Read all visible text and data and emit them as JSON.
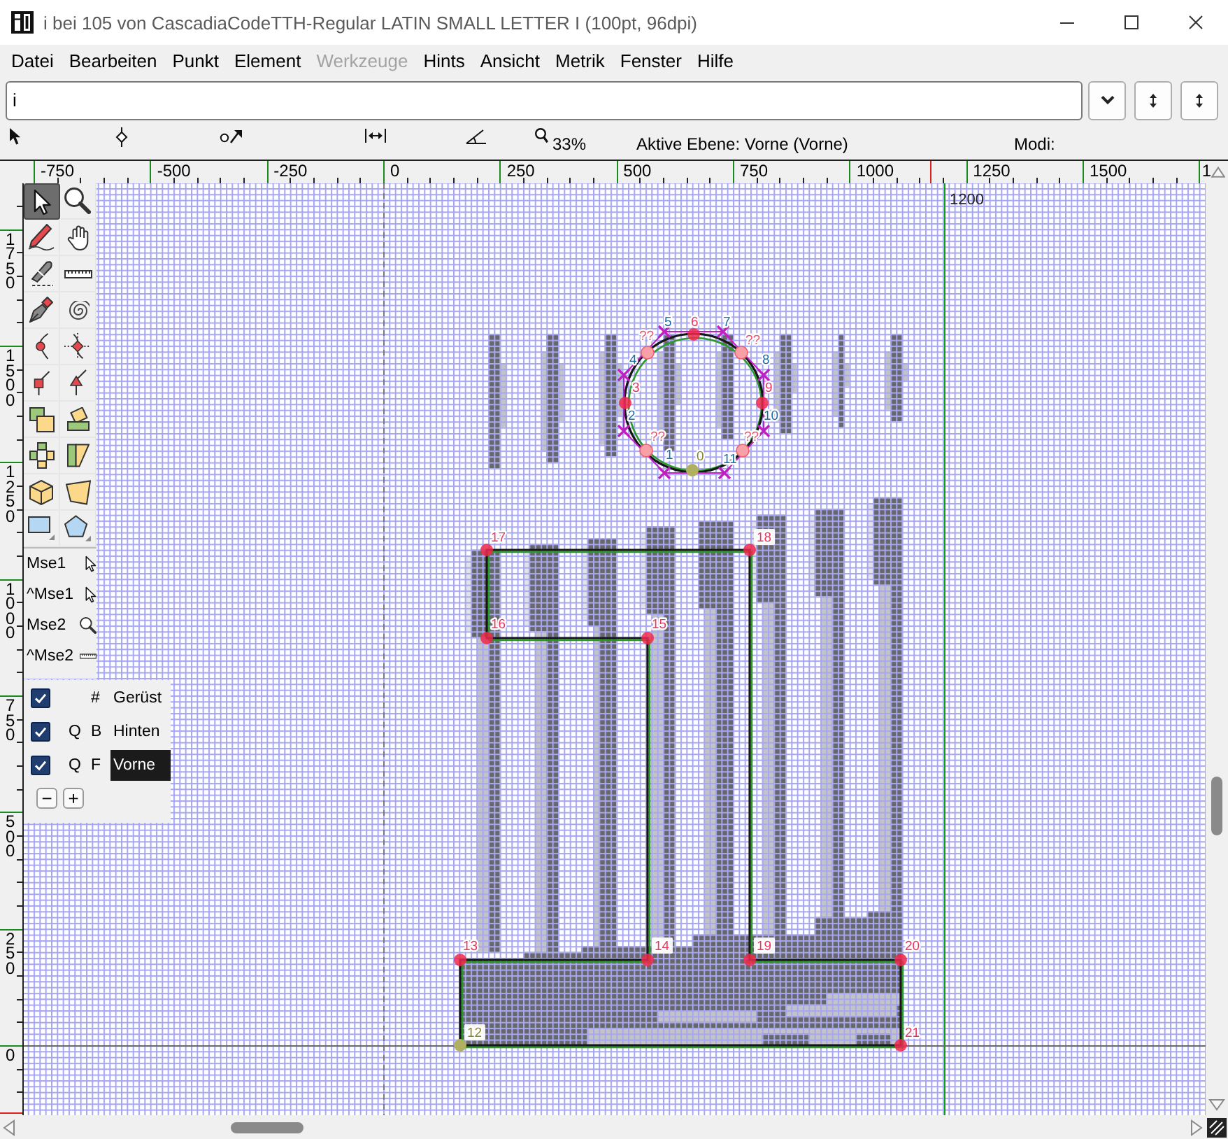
{
  "window": {
    "title": "i bei 105 von CascadiaCodeTTH-Regular LATIN SMALL LETTER I (100pt, 96dpi)"
  },
  "menu": [
    {
      "label": "Datei",
      "disabled": false
    },
    {
      "label": "Bearbeiten",
      "disabled": false
    },
    {
      "label": "Punkt",
      "disabled": false
    },
    {
      "label": "Element",
      "disabled": false
    },
    {
      "label": "Werkzeuge",
      "disabled": true
    },
    {
      "label": "Hints",
      "disabled": false
    },
    {
      "label": "Ansicht",
      "disabled": false
    },
    {
      "label": "Metrik",
      "disabled": false
    },
    {
      "label": "Fenster",
      "disabled": false
    },
    {
      "label": "Hilfe",
      "disabled": false
    }
  ],
  "glyph_field": {
    "value": "i"
  },
  "status": {
    "zoom": "33%",
    "active_layer": "Aktive Ebene: Vorne (Vorne)",
    "modes": "Modi:"
  },
  "ruler_top": {
    "labels": [
      "-750",
      "-500",
      "-250",
      "0",
      "250",
      "500",
      "750",
      "1000",
      "1250",
      "1500",
      "1"
    ]
  },
  "ruler_left": {
    "labels": [
      "1750",
      "1500",
      "1250",
      "1000",
      "750",
      "500",
      "250",
      "0"
    ]
  },
  "tools": [
    {
      "selected": true
    },
    {
      "selected": false
    },
    {
      "selected": false
    },
    {
      "selected": false
    },
    {
      "selected": false
    },
    {
      "selected": false
    },
    {
      "selected": false
    },
    {
      "selected": false
    },
    {
      "selected": false
    },
    {
      "selected": false
    },
    {
      "selected": false
    },
    {
      "selected": false
    },
    {
      "selected": false
    },
    {
      "selected": false
    },
    {
      "selected": false
    },
    {
      "selected": false
    },
    {
      "selected": false
    },
    {
      "selected": false
    },
    {
      "selected": false
    },
    {
      "selected": false
    }
  ],
  "mouse_bindings": [
    "Mse1",
    "^Mse1",
    "Mse2",
    "^Mse2"
  ],
  "layers": {
    "items": [
      {
        "visible": true,
        "type": "#",
        "name": "Gerüst",
        "selected": false
      },
      {
        "visible": true,
        "quadratic": "Q",
        "type": "B",
        "name": "Hinten",
        "selected": false
      },
      {
        "visible": true,
        "quadratic": "Q",
        "type": "F",
        "name": "Vorne",
        "selected": true
      }
    ],
    "buttons": [
      "−",
      "+"
    ]
  },
  "canvas": {
    "advance_width_label": "1200",
    "points": [
      {
        "label": "5",
        "kind": "off"
      },
      {
        "label": "6",
        "kind": "on"
      },
      {
        "label": "7",
        "kind": "off"
      },
      {
        "label": "??",
        "kind": "implied"
      },
      {
        "label": "??",
        "kind": "implied"
      },
      {
        "label": "4",
        "kind": "off"
      },
      {
        "label": "8",
        "kind": "off"
      },
      {
        "label": "3",
        "kind": "on"
      },
      {
        "label": "9",
        "kind": "on"
      },
      {
        "label": "2",
        "kind": "off"
      },
      {
        "label": "10",
        "kind": "off"
      },
      {
        "label": "??",
        "kind": "implied"
      },
      {
        "label": "??",
        "kind": "implied"
      },
      {
        "label": "1",
        "kind": "off"
      },
      {
        "label": "0",
        "kind": "start"
      },
      {
        "label": "11",
        "kind": "off"
      },
      {
        "label": "17",
        "kind": "on"
      },
      {
        "label": "18",
        "kind": "on"
      },
      {
        "label": "16",
        "kind": "on"
      },
      {
        "label": "15",
        "kind": "on"
      },
      {
        "label": "13",
        "kind": "on"
      },
      {
        "label": "14",
        "kind": "on"
      },
      {
        "label": "19",
        "kind": "on"
      },
      {
        "label": "20",
        "kind": "on"
      },
      {
        "label": "12",
        "kind": "start"
      },
      {
        "label": "21",
        "kind": "on"
      }
    ]
  }
}
